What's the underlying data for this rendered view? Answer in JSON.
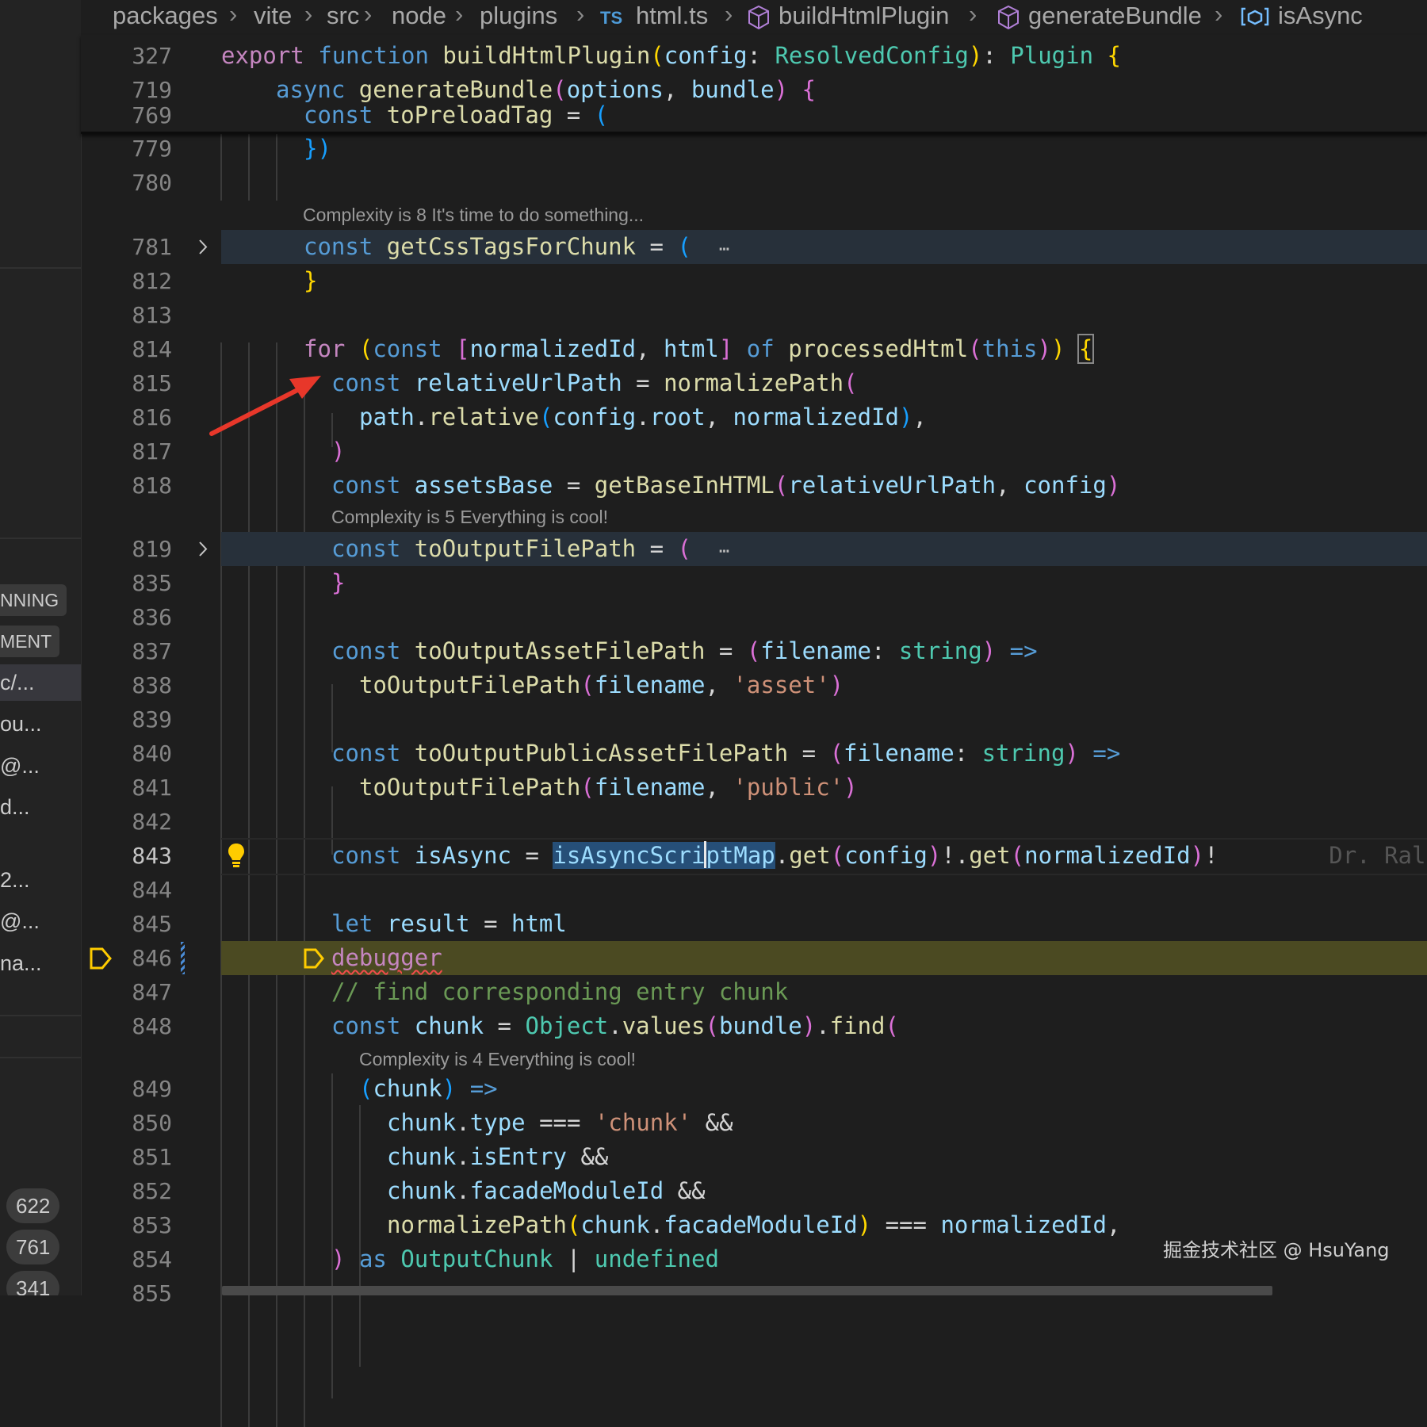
{
  "sidebar": {
    "chips": [
      "NNING",
      "MENT"
    ],
    "items": [
      "c/...",
      "ou...",
      "@...",
      "d...",
      "2...",
      "@...",
      "na..."
    ],
    "badges": [
      "622",
      "761",
      "341"
    ]
  },
  "breadcrumb": {
    "items": [
      "packages",
      "vite",
      "src",
      "node",
      "plugins",
      "html.ts",
      "buildHtmlPlugin",
      "generateBundle",
      "isAsync"
    ],
    "ts_icon_label": "TS"
  },
  "sticky": {
    "line_numbers": [
      "327",
      "719",
      "769"
    ],
    "code": [
      "export function buildHtmlPlugin(config: ResolvedConfig): Plugin {",
      "  async generateBundle(options, bundle) {",
      "    const toPreloadTag = ("
    ]
  },
  "editor": {
    "line_numbers": [
      "779",
      "780",
      "781",
      "812",
      "813",
      "814",
      "815",
      "816",
      "817",
      "818",
      "819",
      "835",
      "836",
      "837",
      "838",
      "839",
      "840",
      "841",
      "842",
      "843",
      "844",
      "845",
      "846",
      "847",
      "848",
      "849",
      "850",
      "851",
      "852",
      "853",
      "854",
      "855"
    ],
    "current_line": "843",
    "debugger_line": "846",
    "code": {
      "l779": "})",
      "l781": "const getCssTagsForChunk = (",
      "l812": "}",
      "l814": "for (const [normalizedId, html] of processedHtml(this)) {",
      "l815": "const relativeUrlPath = normalizePath(",
      "l816": "path.relative(config.root, normalizedId),",
      "l817": ")",
      "l818": "const assetsBase = getBaseInHTML(relativeUrlPath, config)",
      "l819": "const toOutputFilePath = (",
      "l835": "}",
      "l837": "const toOutputAssetFilePath = (filename: string) =>",
      "l838": "toOutputFilePath(filename, 'asset')",
      "l840": "const toOutputPublicAssetFilePath = (filename: string) =>",
      "l841": "toOutputFilePath(filename, 'public')",
      "l843": "const isAsync = isAsyncScriptMap.get(config)!.get(normalizedId)!",
      "l845": "let result = html",
      "l846": "debugger",
      "l847": "// find corresponding entry chunk",
      "l848": "const chunk = Object.values(bundle).find(",
      "l849": "(chunk) =>",
      "l850": "chunk.type === 'chunk' &&",
      "l851": "chunk.isEntry &&",
      "l852": "chunk.facadeModuleId &&",
      "l853": "normalizePath(chunk.facadeModuleId) === normalizedId,",
      "l854": ") as OutputChunk | undefined"
    },
    "fold_ellipsis": "⋯",
    "blame": "Dr. Ralf S",
    "hints": [
      "Complexity is 8 It's time to do something...",
      "Complexity is 5 Everything is cool!",
      "Complexity is 4 Everything is cool!"
    ]
  },
  "colors": {
    "keyword": "#569cd6",
    "control": "#c586c0",
    "function": "#dcdcaa",
    "variable": "#9cdcfe",
    "type": "#4ec9b0",
    "string": "#ce9178",
    "comment": "#6a9955",
    "arrow_annotation": "#e8372a",
    "debugger_line_bg": "#4b4a22"
  },
  "icons": [
    "chevron-right-icon",
    "cube-icon",
    "variable-icon",
    "lightbulb-icon",
    "breakpoint-icon",
    "arrow-annotation"
  ],
  "watermark": "掘金技术社区 @ HsuYang"
}
